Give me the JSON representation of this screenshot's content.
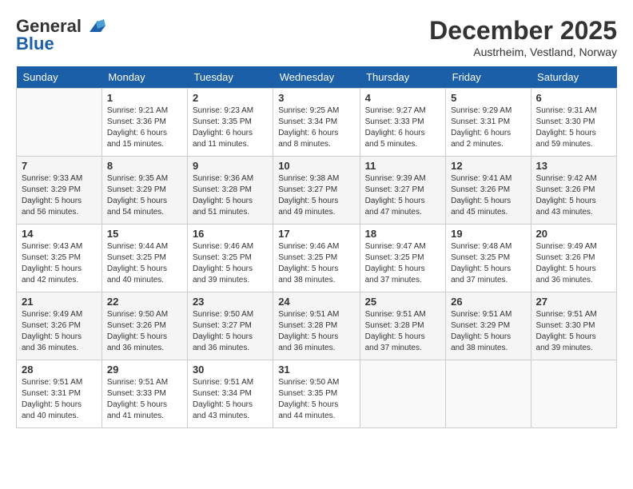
{
  "logo": {
    "line1": "General",
    "line2": "Blue"
  },
  "title": "December 2025",
  "location": "Austrheim, Vestland, Norway",
  "headers": [
    "Sunday",
    "Monday",
    "Tuesday",
    "Wednesday",
    "Thursday",
    "Friday",
    "Saturday"
  ],
  "weeks": [
    [
      {
        "day": "",
        "info": ""
      },
      {
        "day": "1",
        "info": "Sunrise: 9:21 AM\nSunset: 3:36 PM\nDaylight: 6 hours\nand 15 minutes."
      },
      {
        "day": "2",
        "info": "Sunrise: 9:23 AM\nSunset: 3:35 PM\nDaylight: 6 hours\nand 11 minutes."
      },
      {
        "day": "3",
        "info": "Sunrise: 9:25 AM\nSunset: 3:34 PM\nDaylight: 6 hours\nand 8 minutes."
      },
      {
        "day": "4",
        "info": "Sunrise: 9:27 AM\nSunset: 3:33 PM\nDaylight: 6 hours\nand 5 minutes."
      },
      {
        "day": "5",
        "info": "Sunrise: 9:29 AM\nSunset: 3:31 PM\nDaylight: 6 hours\nand 2 minutes."
      },
      {
        "day": "6",
        "info": "Sunrise: 9:31 AM\nSunset: 3:30 PM\nDaylight: 5 hours\nand 59 minutes."
      }
    ],
    [
      {
        "day": "7",
        "info": "Sunrise: 9:33 AM\nSunset: 3:29 PM\nDaylight: 5 hours\nand 56 minutes."
      },
      {
        "day": "8",
        "info": "Sunrise: 9:35 AM\nSunset: 3:29 PM\nDaylight: 5 hours\nand 54 minutes."
      },
      {
        "day": "9",
        "info": "Sunrise: 9:36 AM\nSunset: 3:28 PM\nDaylight: 5 hours\nand 51 minutes."
      },
      {
        "day": "10",
        "info": "Sunrise: 9:38 AM\nSunset: 3:27 PM\nDaylight: 5 hours\nand 49 minutes."
      },
      {
        "day": "11",
        "info": "Sunrise: 9:39 AM\nSunset: 3:27 PM\nDaylight: 5 hours\nand 47 minutes."
      },
      {
        "day": "12",
        "info": "Sunrise: 9:41 AM\nSunset: 3:26 PM\nDaylight: 5 hours\nand 45 minutes."
      },
      {
        "day": "13",
        "info": "Sunrise: 9:42 AM\nSunset: 3:26 PM\nDaylight: 5 hours\nand 43 minutes."
      }
    ],
    [
      {
        "day": "14",
        "info": "Sunrise: 9:43 AM\nSunset: 3:25 PM\nDaylight: 5 hours\nand 42 minutes."
      },
      {
        "day": "15",
        "info": "Sunrise: 9:44 AM\nSunset: 3:25 PM\nDaylight: 5 hours\nand 40 minutes."
      },
      {
        "day": "16",
        "info": "Sunrise: 9:46 AM\nSunset: 3:25 PM\nDaylight: 5 hours\nand 39 minutes."
      },
      {
        "day": "17",
        "info": "Sunrise: 9:46 AM\nSunset: 3:25 PM\nDaylight: 5 hours\nand 38 minutes."
      },
      {
        "day": "18",
        "info": "Sunrise: 9:47 AM\nSunset: 3:25 PM\nDaylight: 5 hours\nand 37 minutes."
      },
      {
        "day": "19",
        "info": "Sunrise: 9:48 AM\nSunset: 3:25 PM\nDaylight: 5 hours\nand 37 minutes."
      },
      {
        "day": "20",
        "info": "Sunrise: 9:49 AM\nSunset: 3:26 PM\nDaylight: 5 hours\nand 36 minutes."
      }
    ],
    [
      {
        "day": "21",
        "info": "Sunrise: 9:49 AM\nSunset: 3:26 PM\nDaylight: 5 hours\nand 36 minutes."
      },
      {
        "day": "22",
        "info": "Sunrise: 9:50 AM\nSunset: 3:26 PM\nDaylight: 5 hours\nand 36 minutes."
      },
      {
        "day": "23",
        "info": "Sunrise: 9:50 AM\nSunset: 3:27 PM\nDaylight: 5 hours\nand 36 minutes."
      },
      {
        "day": "24",
        "info": "Sunrise: 9:51 AM\nSunset: 3:28 PM\nDaylight: 5 hours\nand 36 minutes."
      },
      {
        "day": "25",
        "info": "Sunrise: 9:51 AM\nSunset: 3:28 PM\nDaylight: 5 hours\nand 37 minutes."
      },
      {
        "day": "26",
        "info": "Sunrise: 9:51 AM\nSunset: 3:29 PM\nDaylight: 5 hours\nand 38 minutes."
      },
      {
        "day": "27",
        "info": "Sunrise: 9:51 AM\nSunset: 3:30 PM\nDaylight: 5 hours\nand 39 minutes."
      }
    ],
    [
      {
        "day": "28",
        "info": "Sunrise: 9:51 AM\nSunset: 3:31 PM\nDaylight: 5 hours\nand 40 minutes."
      },
      {
        "day": "29",
        "info": "Sunrise: 9:51 AM\nSunset: 3:33 PM\nDaylight: 5 hours\nand 41 minutes."
      },
      {
        "day": "30",
        "info": "Sunrise: 9:51 AM\nSunset: 3:34 PM\nDaylight: 5 hours\nand 43 minutes."
      },
      {
        "day": "31",
        "info": "Sunrise: 9:50 AM\nSunset: 3:35 PM\nDaylight: 5 hours\nand 44 minutes."
      },
      {
        "day": "",
        "info": ""
      },
      {
        "day": "",
        "info": ""
      },
      {
        "day": "",
        "info": ""
      }
    ]
  ]
}
